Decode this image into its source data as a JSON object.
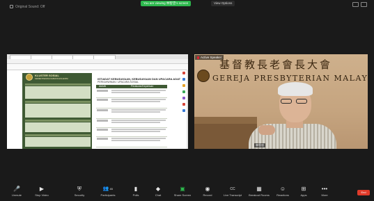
{
  "top_bar": {
    "original_sound_label": "Original Sound: Off",
    "share_banner": "You are viewing 林智忠's screen",
    "view_options_label": "View Options"
  },
  "shared_doc": {
    "left_title": "KLUSTER SOSIAL",
    "left_subtitle": "KEMENTERIAN/JABATAN/AGENSI",
    "right_title": "ISTIADAT KEBUDAYAAN, KEBUDAYAAN DAN UPACARA ADAT",
    "right_subtitle": "PERKAHWINAN / UPACARA SOSIAL",
    "col_activity": "Aktiviti",
    "col_requirement": "Peraturan/Keperluan"
  },
  "video": {
    "speaker_name": "Active Speaker",
    "banner_top": "基督教長老會長大會",
    "banner_sub": "GEREJA PRESBYTERIAN MALAYSIA",
    "bottom_name": "林智忠"
  },
  "toolbar": {
    "items": [
      {
        "label": "Unmute",
        "icon": "mic-muted-icon"
      },
      {
        "label": "Stop Video",
        "icon": "video-icon"
      },
      {
        "label": "Security",
        "icon": "shield-icon"
      },
      {
        "label": "Participants",
        "icon": "participants-icon",
        "count": "85"
      },
      {
        "label": "Polls",
        "icon": "polls-icon"
      },
      {
        "label": "Chat",
        "icon": "chat-icon"
      },
      {
        "label": "Share Screen",
        "icon": "share-screen-icon"
      },
      {
        "label": "Record",
        "icon": "record-icon"
      },
      {
        "label": "Live Transcript",
        "icon": "cc-icon"
      },
      {
        "label": "Breakout Rooms",
        "icon": "breakout-icon"
      },
      {
        "label": "Reactions",
        "icon": "reactions-icon"
      },
      {
        "label": "Apps",
        "icon": "apps-icon"
      },
      {
        "label": "More",
        "icon": "more-icon"
      }
    ],
    "end_label": "End"
  },
  "colors": {
    "share_green": "#2db84d",
    "end_red": "#e03b2a",
    "doc_green": "#3f5a34"
  }
}
